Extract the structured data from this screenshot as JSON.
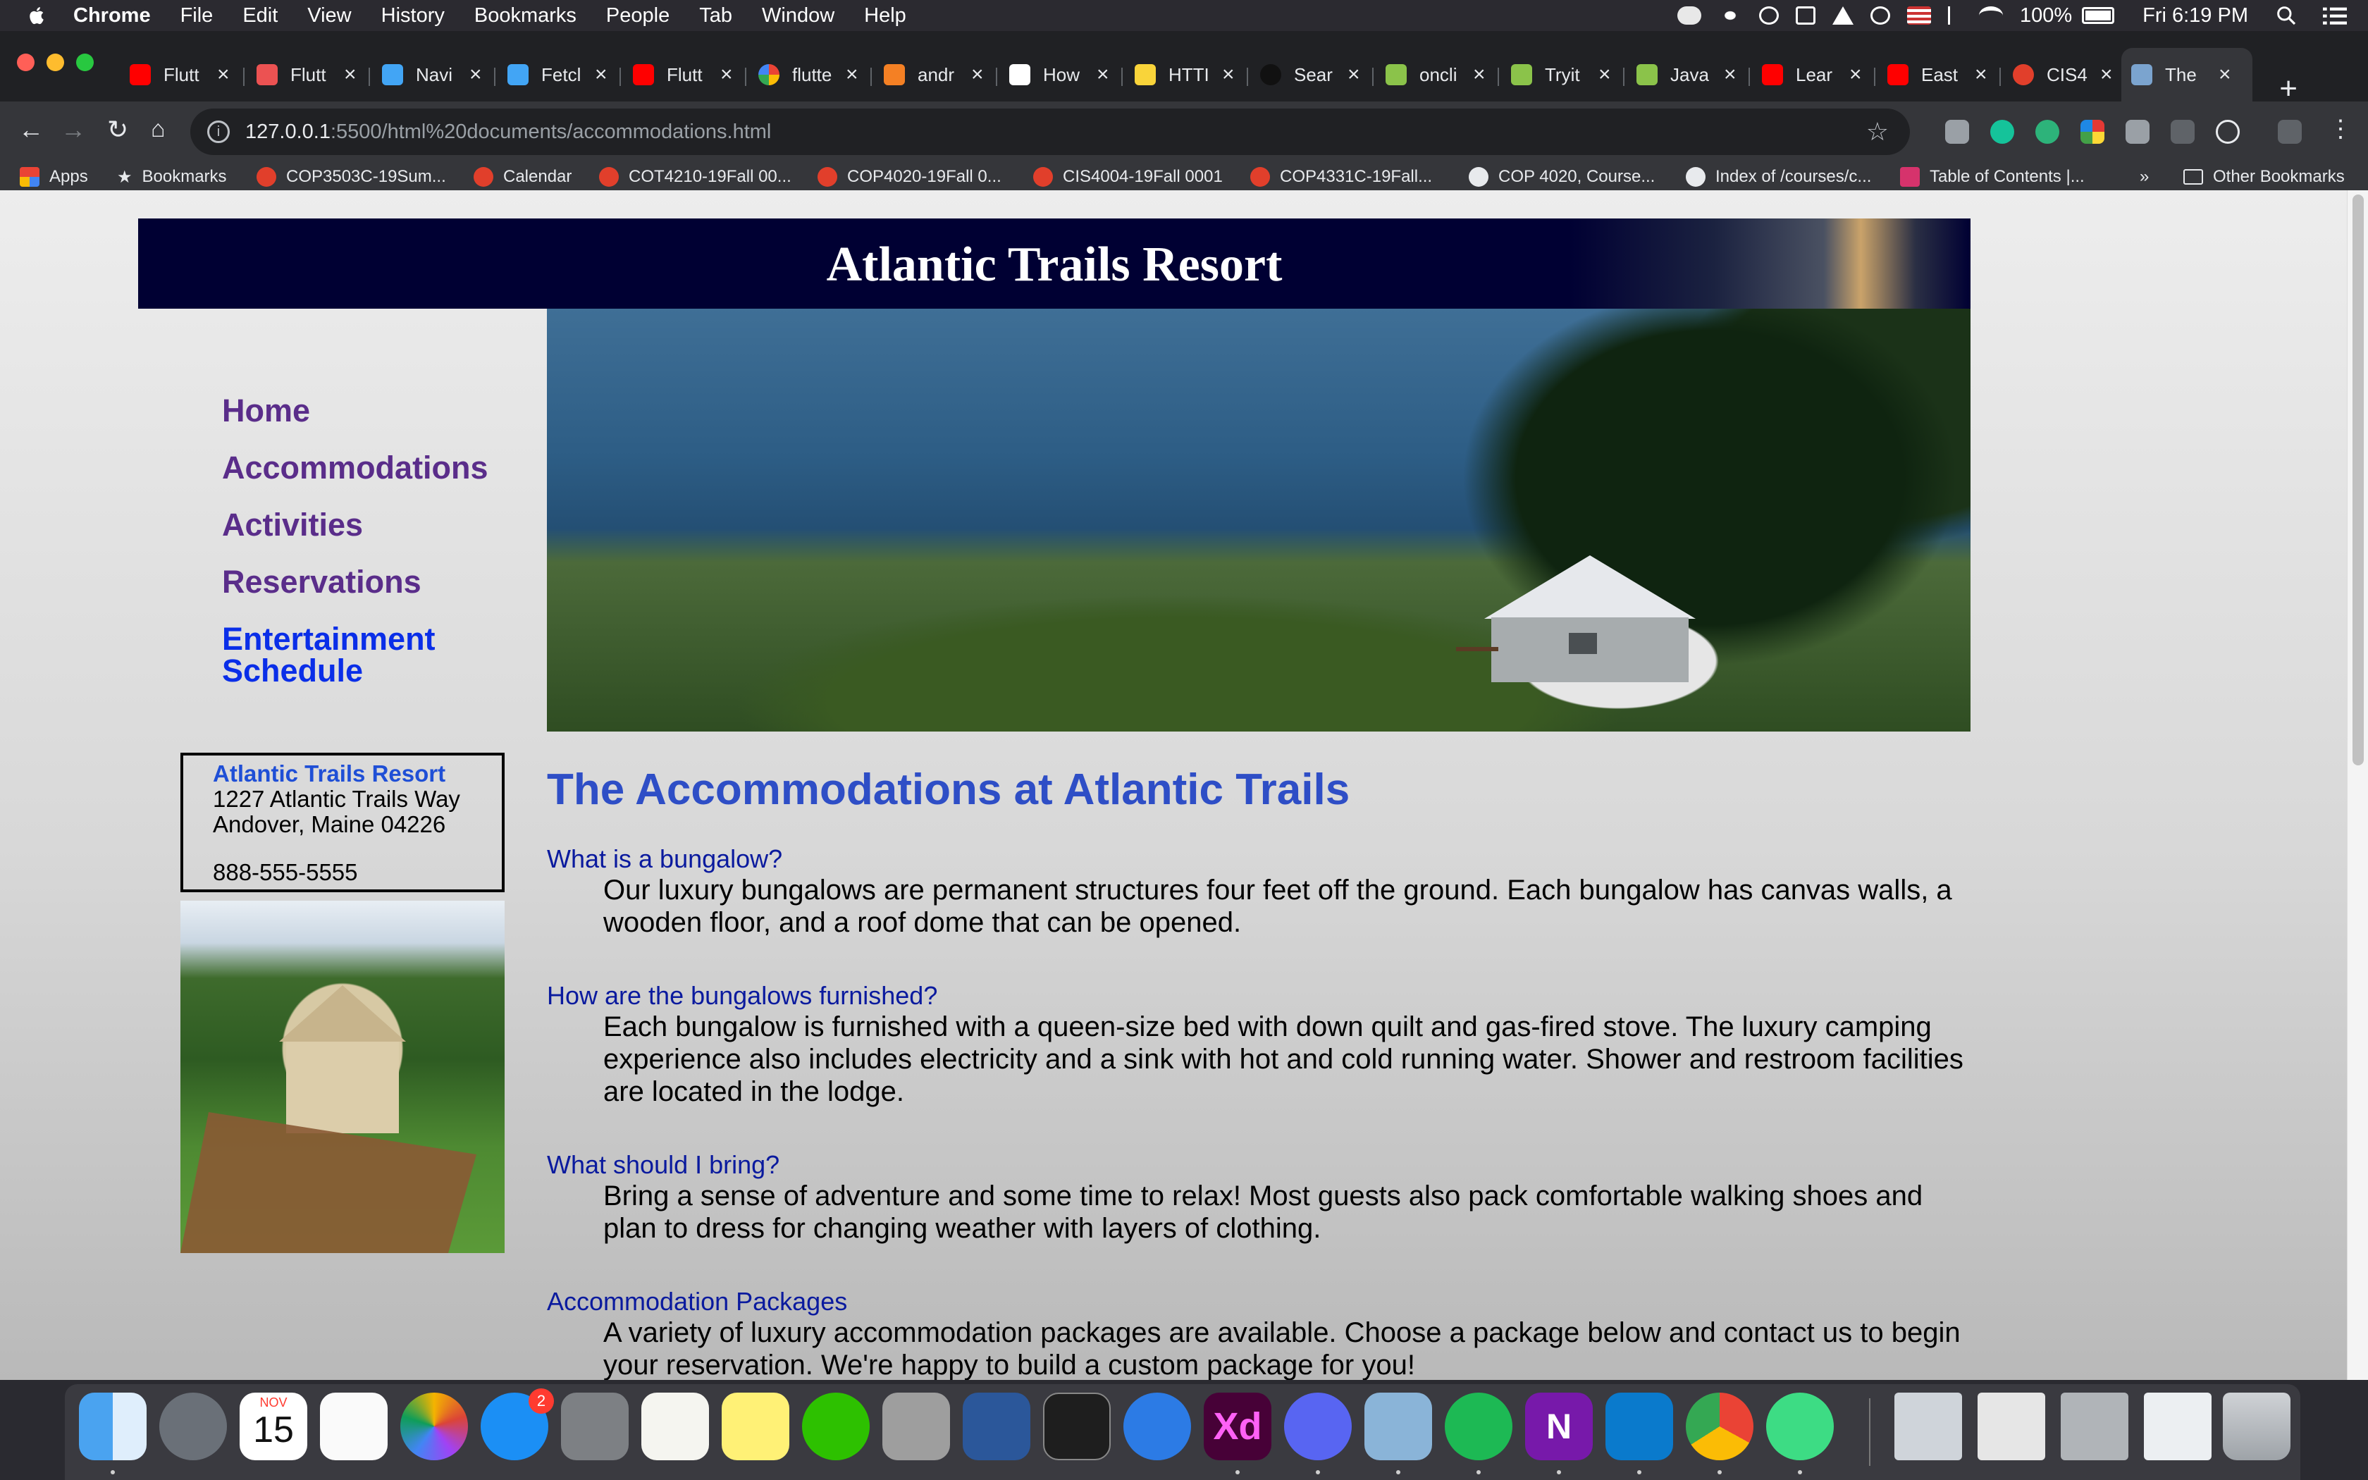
{
  "menubar": {
    "app_name": "Chrome",
    "menus": [
      "File",
      "Edit",
      "View",
      "History",
      "Bookmarks",
      "People",
      "Tab",
      "Window",
      "Help"
    ],
    "battery": "100%",
    "clock": "Fri 6:19 PM"
  },
  "tabs": [
    {
      "title": "Flutt",
      "icon": "youtube-icon"
    },
    {
      "title": "Flutt",
      "icon": "udemy-icon"
    },
    {
      "title": "Navi",
      "icon": "flutter-icon"
    },
    {
      "title": "Fetcl",
      "icon": "flutter-icon"
    },
    {
      "title": "Flutt",
      "icon": "youtube-icon"
    },
    {
      "title": "flutte",
      "icon": "google-icon"
    },
    {
      "title": "andr",
      "icon": "stackoverflow-icon"
    },
    {
      "title": "How",
      "icon": "medium-icon"
    },
    {
      "title": "HTTI",
      "icon": "pub-icon"
    },
    {
      "title": "Sear",
      "icon": "github-icon"
    },
    {
      "title": "oncli",
      "icon": "w3schools-icon"
    },
    {
      "title": "Tryit",
      "icon": "w3schools-icon"
    },
    {
      "title": "Java",
      "icon": "w3schools-icon"
    },
    {
      "title": "Lear",
      "icon": "youtube-icon"
    },
    {
      "title": "East",
      "icon": "youtube-icon"
    },
    {
      "title": "CIS4",
      "icon": "canvas-icon"
    },
    {
      "title": "The",
      "icon": "page-icon",
      "active": true
    }
  ],
  "address_bar": {
    "host": "127.0.0.1",
    "path": ":5500/html%20documents/accommodations.html"
  },
  "bookmarks": [
    "Apps",
    "Bookmarks",
    "COP3503C-19Sum...",
    "Calendar",
    "COT4210-19Fall 00...",
    "COP4020-19Fall 0...",
    "CIS4004-19Fall 0001",
    "COP4331C-19Fall...",
    "COP 4020, Course...",
    "Index of /courses/c...",
    "Table of Contents |...",
    "Other Bookmarks"
  ],
  "bookmarks_overflow": "»",
  "page": {
    "site_title": "Atlantic Trails Resort",
    "nav": [
      "Home",
      "Accommodations",
      "Activities",
      "Reservations"
    ],
    "nav_entertainment": [
      "Entertainment",
      "Schedule"
    ],
    "contact": {
      "name": "Atlantic Trails Resort",
      "street": "1227 Atlantic Trails Way",
      "city": "Andover, Maine 04226",
      "phone": "888-555-5555"
    },
    "heading": "The Accommodations at Atlantic Trails",
    "faq": [
      {
        "q": "What is a bungalow?",
        "a": "Our luxury bungalows are permanent structures four feet off the ground. Each bungalow has canvas walls, a wooden floor, and a roof dome that can be opened."
      },
      {
        "q": "How are the bungalows furnished?",
        "a": "Each bungalow is furnished with a queen-size bed with down quilt and gas-fired stove. The luxury camping experience also includes electricity and a sink with hot and cold running water. Shower and restroom facilities are located in the lodge."
      },
      {
        "q": "What should I bring?",
        "a": "Bring a sense of adventure and some time to relax! Most guests also pack comfortable walking shoes and plan to dress for changing weather with layers of clothing."
      },
      {
        "q": "Accommodation Packages",
        "a": "A variety of luxury accommodation packages are available. Choose a package below and contact us to begin your reservation. We're happy to build a custom package for you!"
      }
    ]
  },
  "dock": {
    "calendar_month": "NOV",
    "calendar_day": "15",
    "appstore_badge": "2",
    "xd_label": "Xd",
    "onenote_label": "N"
  }
}
